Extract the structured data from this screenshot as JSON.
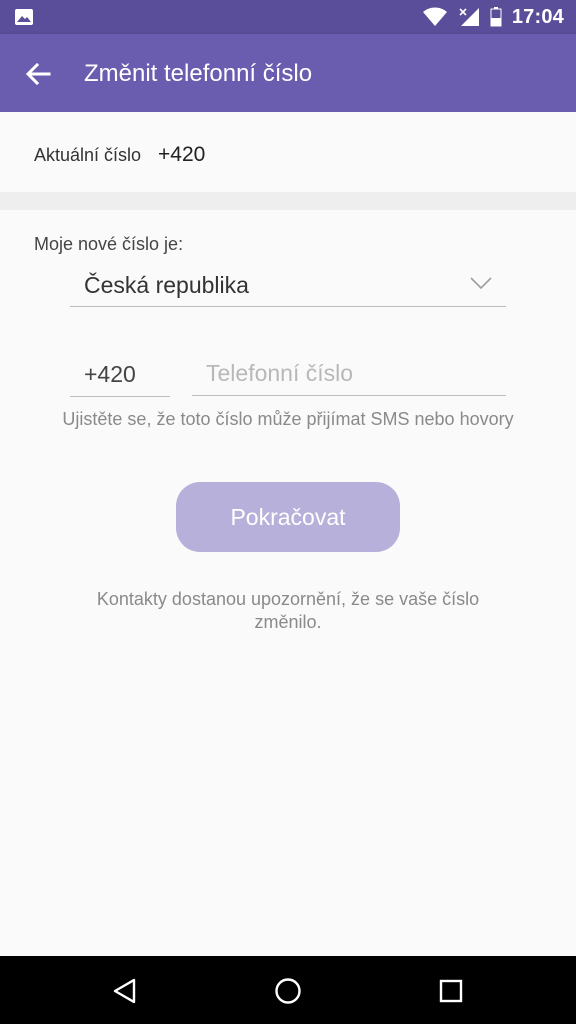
{
  "status_bar": {
    "time": "17:04",
    "icons": [
      "image-notification-icon",
      "wifi-icon",
      "signal-icon",
      "battery-icon"
    ]
  },
  "app_bar": {
    "title": "Změnit telefonní číslo",
    "back_icon": "arrow-left-icon"
  },
  "current_number": {
    "label": "Aktuální číslo",
    "value": "+420"
  },
  "new_number": {
    "label": "Moje nové číslo je:",
    "country": "Česká republika",
    "country_code": "+420",
    "phone_placeholder": "Telefonní číslo",
    "phone_value": "",
    "hint": "Ujistěte se, že toto číslo může přijímat SMS nebo hovory"
  },
  "continue_label": "Pokračovat",
  "notice": "Kontakty dostanou upozornění, že se vaše číslo změnilo.",
  "nav_bar": {
    "icons": [
      "back-triangle-icon",
      "home-circle-icon",
      "recents-square-icon"
    ]
  },
  "colors": {
    "status_bar": "#5a4d9a",
    "app_bar": "#6a5db0",
    "button_disabled": "#b7b0da"
  }
}
